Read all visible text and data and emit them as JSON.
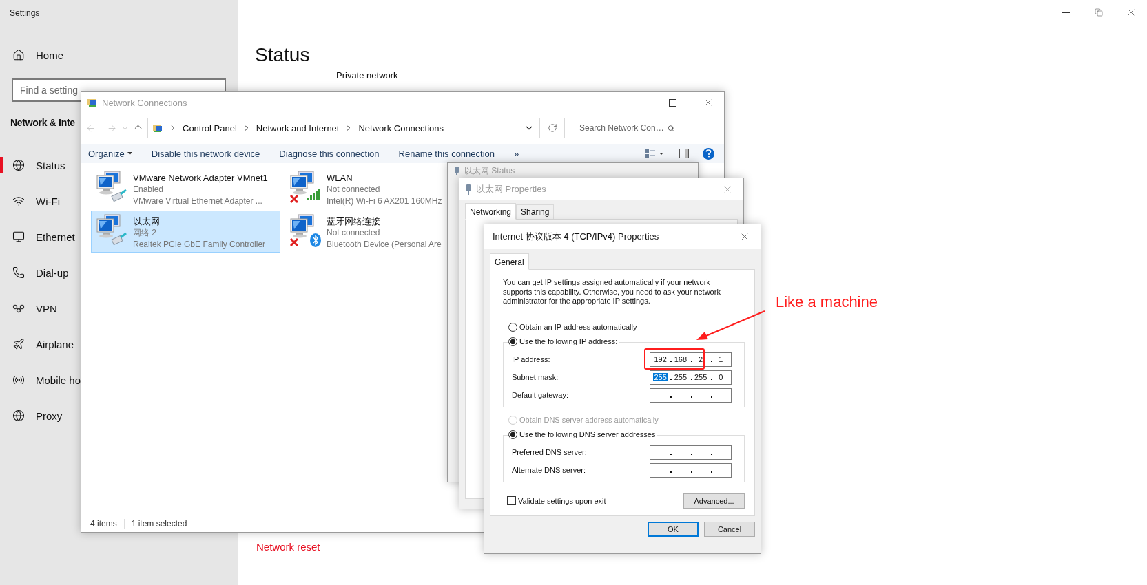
{
  "settings": {
    "title": "Settings",
    "home": "Home",
    "search": {
      "placeholder": "Find a setting"
    },
    "section": "Network & Inte",
    "nav": [
      {
        "label": "Status",
        "selected": true
      },
      {
        "label": "Wi-Fi",
        "selected": false
      },
      {
        "label": "Ethernet",
        "selected": false
      },
      {
        "label": "Dial-up",
        "selected": false
      },
      {
        "label": "VPN",
        "selected": false
      },
      {
        "label": "Airplane",
        "selected": false
      },
      {
        "label": "Mobile ho",
        "selected": false
      },
      {
        "label": "Proxy",
        "selected": false
      }
    ]
  },
  "main": {
    "heading": "Status",
    "subtitle": "Private network",
    "link": "Network reset"
  },
  "network_connections": {
    "title": "Network Connections",
    "breadcrumb": [
      "Control Panel",
      "Network and Internet",
      "Network Connections"
    ],
    "search": {
      "placeholder": "Search Network Con…"
    },
    "toolbar": [
      {
        "label": "Organize",
        "kind": "menu"
      },
      {
        "label": "Disable this network device",
        "kind": "command"
      },
      {
        "label": "Diagnose this connection",
        "kind": "command"
      },
      {
        "label": "Rename this connection",
        "kind": "command"
      },
      {
        "label": "»",
        "kind": "more"
      }
    ],
    "adapters": [
      {
        "name": "VMware Network Adapter VMnet1",
        "status": "Enabled",
        "device": "VMware Virtual Ethernet Adapter ...",
        "kind": "wired",
        "connected": true,
        "selected": false
      },
      {
        "name": "WLAN",
        "status": "Not connected",
        "device": "Intel(R) Wi-Fi 6 AX201 160MHz",
        "kind": "wifi",
        "connected": false,
        "selected": false
      },
      {
        "name": "以太网",
        "status": "网络 2",
        "device": "Realtek PCIe GbE Family Controller",
        "kind": "wired",
        "connected": true,
        "selected": true
      },
      {
        "name": "蓝牙网络连接",
        "status": "Not connected",
        "device": "Bluetooth Device (Personal Are",
        "kind": "bluetooth",
        "connected": false,
        "selected": false
      }
    ],
    "status_bar": [
      "4 items",
      "1 item selected"
    ]
  },
  "status_window": {
    "title": "以太网 Status"
  },
  "properties_window": {
    "title": "以太网 Properties",
    "tabs": [
      {
        "label": "Networking",
        "selected": true
      },
      {
        "label": "Sharing",
        "selected": false
      }
    ]
  },
  "ipv4_dialog": {
    "title": "Internet 协议版本 4 (TCP/IPv4) Properties",
    "tabs": [
      {
        "label": "General",
        "selected": true
      }
    ],
    "intro": "You can get IP settings assigned automatically if your network supports this capability. Otherwise, you need to ask your network administrator for the appropriate IP settings.",
    "ip_mode": [
      {
        "label": "Obtain an IP address automatically",
        "selected": false,
        "disabled": false
      },
      {
        "label": "Use the following IP address:",
        "selected": true,
        "disabled": false
      }
    ],
    "ip_fields": [
      {
        "label": "IP address:",
        "octets": [
          {
            "text": "192",
            "selected": false
          },
          {
            "text": "168",
            "selected": false
          },
          {
            "text": "2",
            "selected": false
          },
          {
            "text": "1",
            "selected": false
          }
        ]
      },
      {
        "label": "Subnet mask:",
        "octets": [
          {
            "text": "255",
            "selected": true
          },
          {
            "text": "255",
            "selected": false
          },
          {
            "text": "255",
            "selected": false
          },
          {
            "text": "0",
            "selected": false
          }
        ]
      },
      {
        "label": "Default gateway:"
      }
    ],
    "dns_mode": [
      {
        "label": "Obtain DNS server address automatically",
        "selected": false,
        "disabled": true
      },
      {
        "label": "Use the following DNS server addresses",
        "selected": true,
        "disabled": false
      }
    ],
    "dns_fields": [
      {
        "label": "Preferred DNS server:"
      },
      {
        "label": "Alternate DNS server:"
      }
    ],
    "validate": {
      "label": "Validate settings upon exit",
      "checked": false
    },
    "advanced": "Advanced...",
    "buttons": [
      {
        "label": "OK",
        "kind": "default"
      },
      {
        "label": "Cancel",
        "kind": "normal"
      }
    ]
  },
  "annotation": {
    "text": "Like a machine"
  }
}
